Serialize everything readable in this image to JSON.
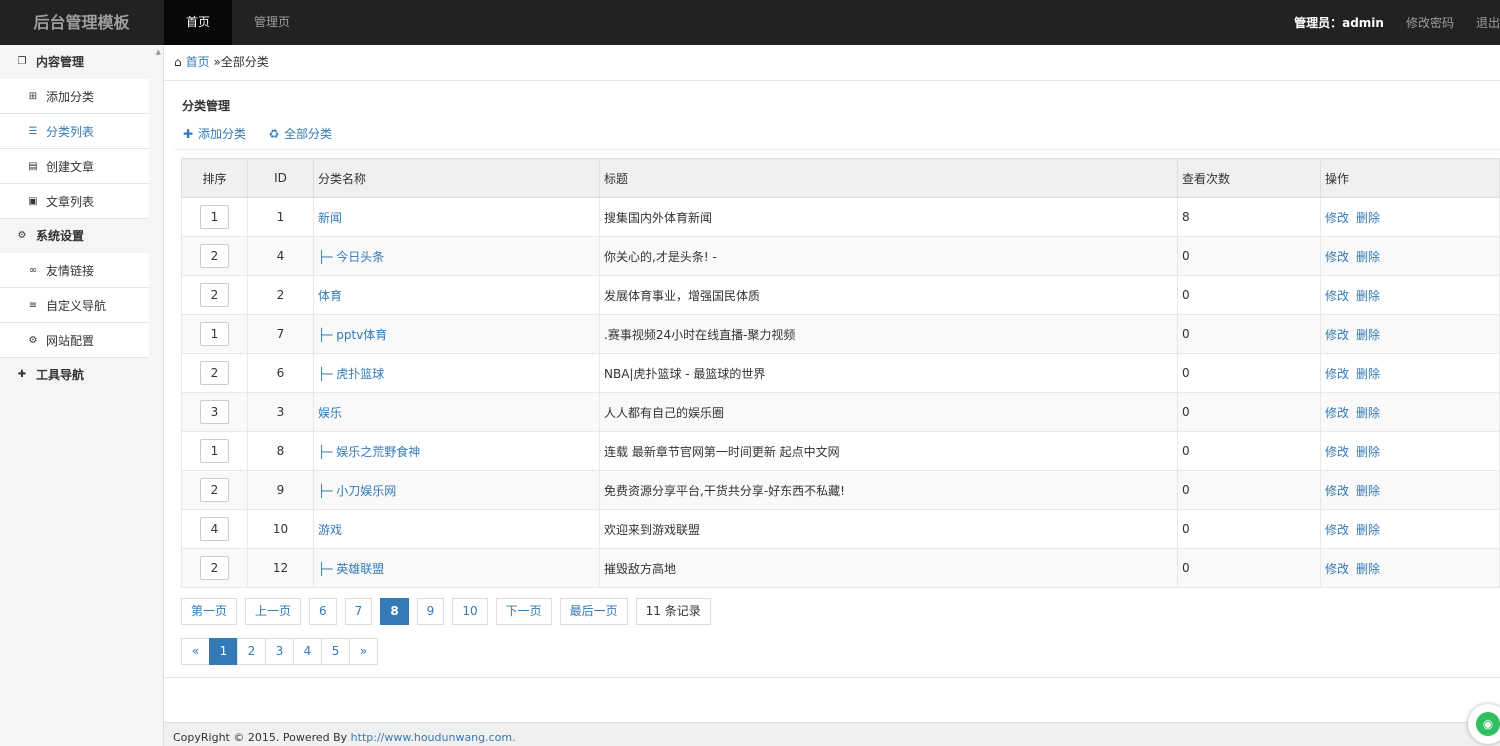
{
  "brand": "后台管理模板",
  "topnav": [
    {
      "label": "首页",
      "active": true
    },
    {
      "label": "管理页",
      "active": false
    }
  ],
  "topright": {
    "admin": "管理员：admin",
    "change_password": "修改密码",
    "logout": "退出"
  },
  "sidebar": {
    "groups": [
      {
        "label": "内容管理",
        "icon": "copy-icon"
      },
      {
        "label": "系统设置",
        "icon": "gear-icon"
      },
      {
        "label": "工具导航",
        "icon": "pin-icon"
      }
    ],
    "items": [
      {
        "label": "添加分类",
        "icon": "plus-square-icon"
      },
      {
        "label": "分类列表",
        "icon": "list-icon"
      },
      {
        "label": "创建文章",
        "icon": "list-alt-icon"
      },
      {
        "label": "文章列表",
        "icon": "picture-icon"
      },
      {
        "label": "友情链接",
        "icon": "link-icon"
      },
      {
        "label": "自定义导航",
        "icon": "menu-icon"
      },
      {
        "label": "网站配置",
        "icon": "cogs-icon"
      }
    ]
  },
  "breadcrumb": {
    "home": "首页",
    "current": "»全部分类"
  },
  "panel": {
    "title": "分类管理",
    "add_link": "添加分类",
    "all_link": "全部分类"
  },
  "table": {
    "headers": [
      "排序",
      "ID",
      "分类名称",
      "标题",
      "查看次数",
      "操作"
    ],
    "rows": [
      {
        "order": "1",
        "id": "1",
        "name": "新闻",
        "title": "搜集国内外体育新闻",
        "views": "8"
      },
      {
        "order": "2",
        "id": "4",
        "name": "├─ 今日头条",
        "title": "你关心的,才是头条! -",
        "views": "0"
      },
      {
        "order": "2",
        "id": "2",
        "name": "体育",
        "title": "发展体育事业，增强国民体质",
        "views": "0"
      },
      {
        "order": "1",
        "id": "7",
        "name": "├─ pptv体育",
        "title": ".赛事视频24小时在线直播-聚力视频",
        "views": "0"
      },
      {
        "order": "2",
        "id": "6",
        "name": "├─ 虎扑篮球",
        "title": "NBA|虎扑篮球 - 最篮球的世界",
        "views": "0"
      },
      {
        "order": "3",
        "id": "3",
        "name": "娱乐",
        "title": "人人都有自己的娱乐圈",
        "views": "0"
      },
      {
        "order": "1",
        "id": "8",
        "name": "├─ 娱乐之荒野食神",
        "title": "连载 最新章节官网第一时间更新 起点中文网",
        "views": "0"
      },
      {
        "order": "2",
        "id": "9",
        "name": "├─ 小刀娱乐网",
        "title": "免费资源分享平台,干货共分享-好东西不私藏!",
        "views": "0"
      },
      {
        "order": "4",
        "id": "10",
        "name": "游戏",
        "title": "欢迎来到游戏联盟",
        "views": "0"
      },
      {
        "order": "2",
        "id": "12",
        "name": "├─ 英雄联盟",
        "title": "摧毁敌方高地",
        "views": "0"
      }
    ],
    "edit_label": "修改",
    "delete_label": "删除"
  },
  "pager1": {
    "first": "第一页",
    "prev": "上一页",
    "pages": [
      "6",
      "7",
      "8",
      "9",
      "10"
    ],
    "current": "8",
    "next": "下一页",
    "last": "最后一页",
    "total": "11 条记录"
  },
  "pager2": {
    "prev": "«",
    "pages": [
      "1",
      "2",
      "3",
      "4",
      "5"
    ],
    "current": "1",
    "next": "»"
  },
  "footer": {
    "text": "CopyRight © 2015. Powered By ",
    "link": "http://www.houdunwang.com."
  }
}
